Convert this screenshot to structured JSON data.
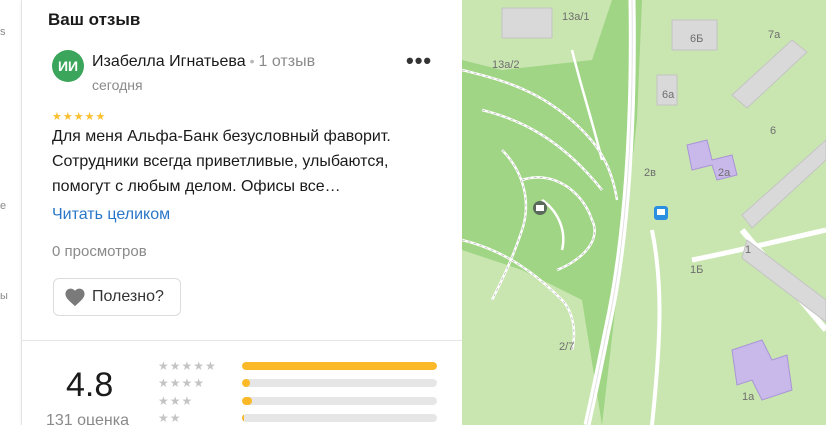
{
  "section_title": "Ваш отзыв",
  "left_strip": {
    "chars": [
      "s",
      "е",
      "ы"
    ]
  },
  "review": {
    "avatar_initials": "ИИ",
    "author": "Изабелла Игнатьева",
    "separator": "•",
    "author_reviews": "1 отзыв",
    "date": "сегодня",
    "more_menu": "•••",
    "stars": "★★★★★",
    "star_rating": 5,
    "text": "Для меня Альфа-Банк безусловный фаворит. Сотрудники всегда приветливые, улыбаются, помогут с любым делом. Офисы все…",
    "read_more": "Читать целиком",
    "views": "0 просмотров",
    "useful_label": "Полезно?",
    "useful_icon": "heart-icon"
  },
  "summary": {
    "rating": "4.8",
    "rating_count": "131 оценка",
    "distribution": [
      {
        "stars": "★★★★★",
        "fraction": 1.0
      },
      {
        "stars": "★★★★",
        "fraction": 0.04
      },
      {
        "stars": "★★★",
        "fraction": 0.05
      },
      {
        "stars": "★★",
        "fraction": 0.01
      }
    ]
  },
  "map": {
    "labels": [
      "13а/1",
      "13а/2",
      "6Б",
      "7а",
      "6а",
      "6",
      "2в",
      "2а",
      "1Б",
      "1",
      "2/7",
      "1а"
    ],
    "colors": {
      "park": "#9fd584",
      "lawn": "#c9e6b0",
      "building": "#d9d9d9",
      "highlight": "#c9b8ea",
      "road": "#ffffff",
      "bus": "#2a8fe0"
    }
  },
  "colors": {
    "accent_link": "#2a77c7",
    "star": "#fbc02d",
    "bar_fill": "#fbb827",
    "avatar": "#3aa55b"
  }
}
